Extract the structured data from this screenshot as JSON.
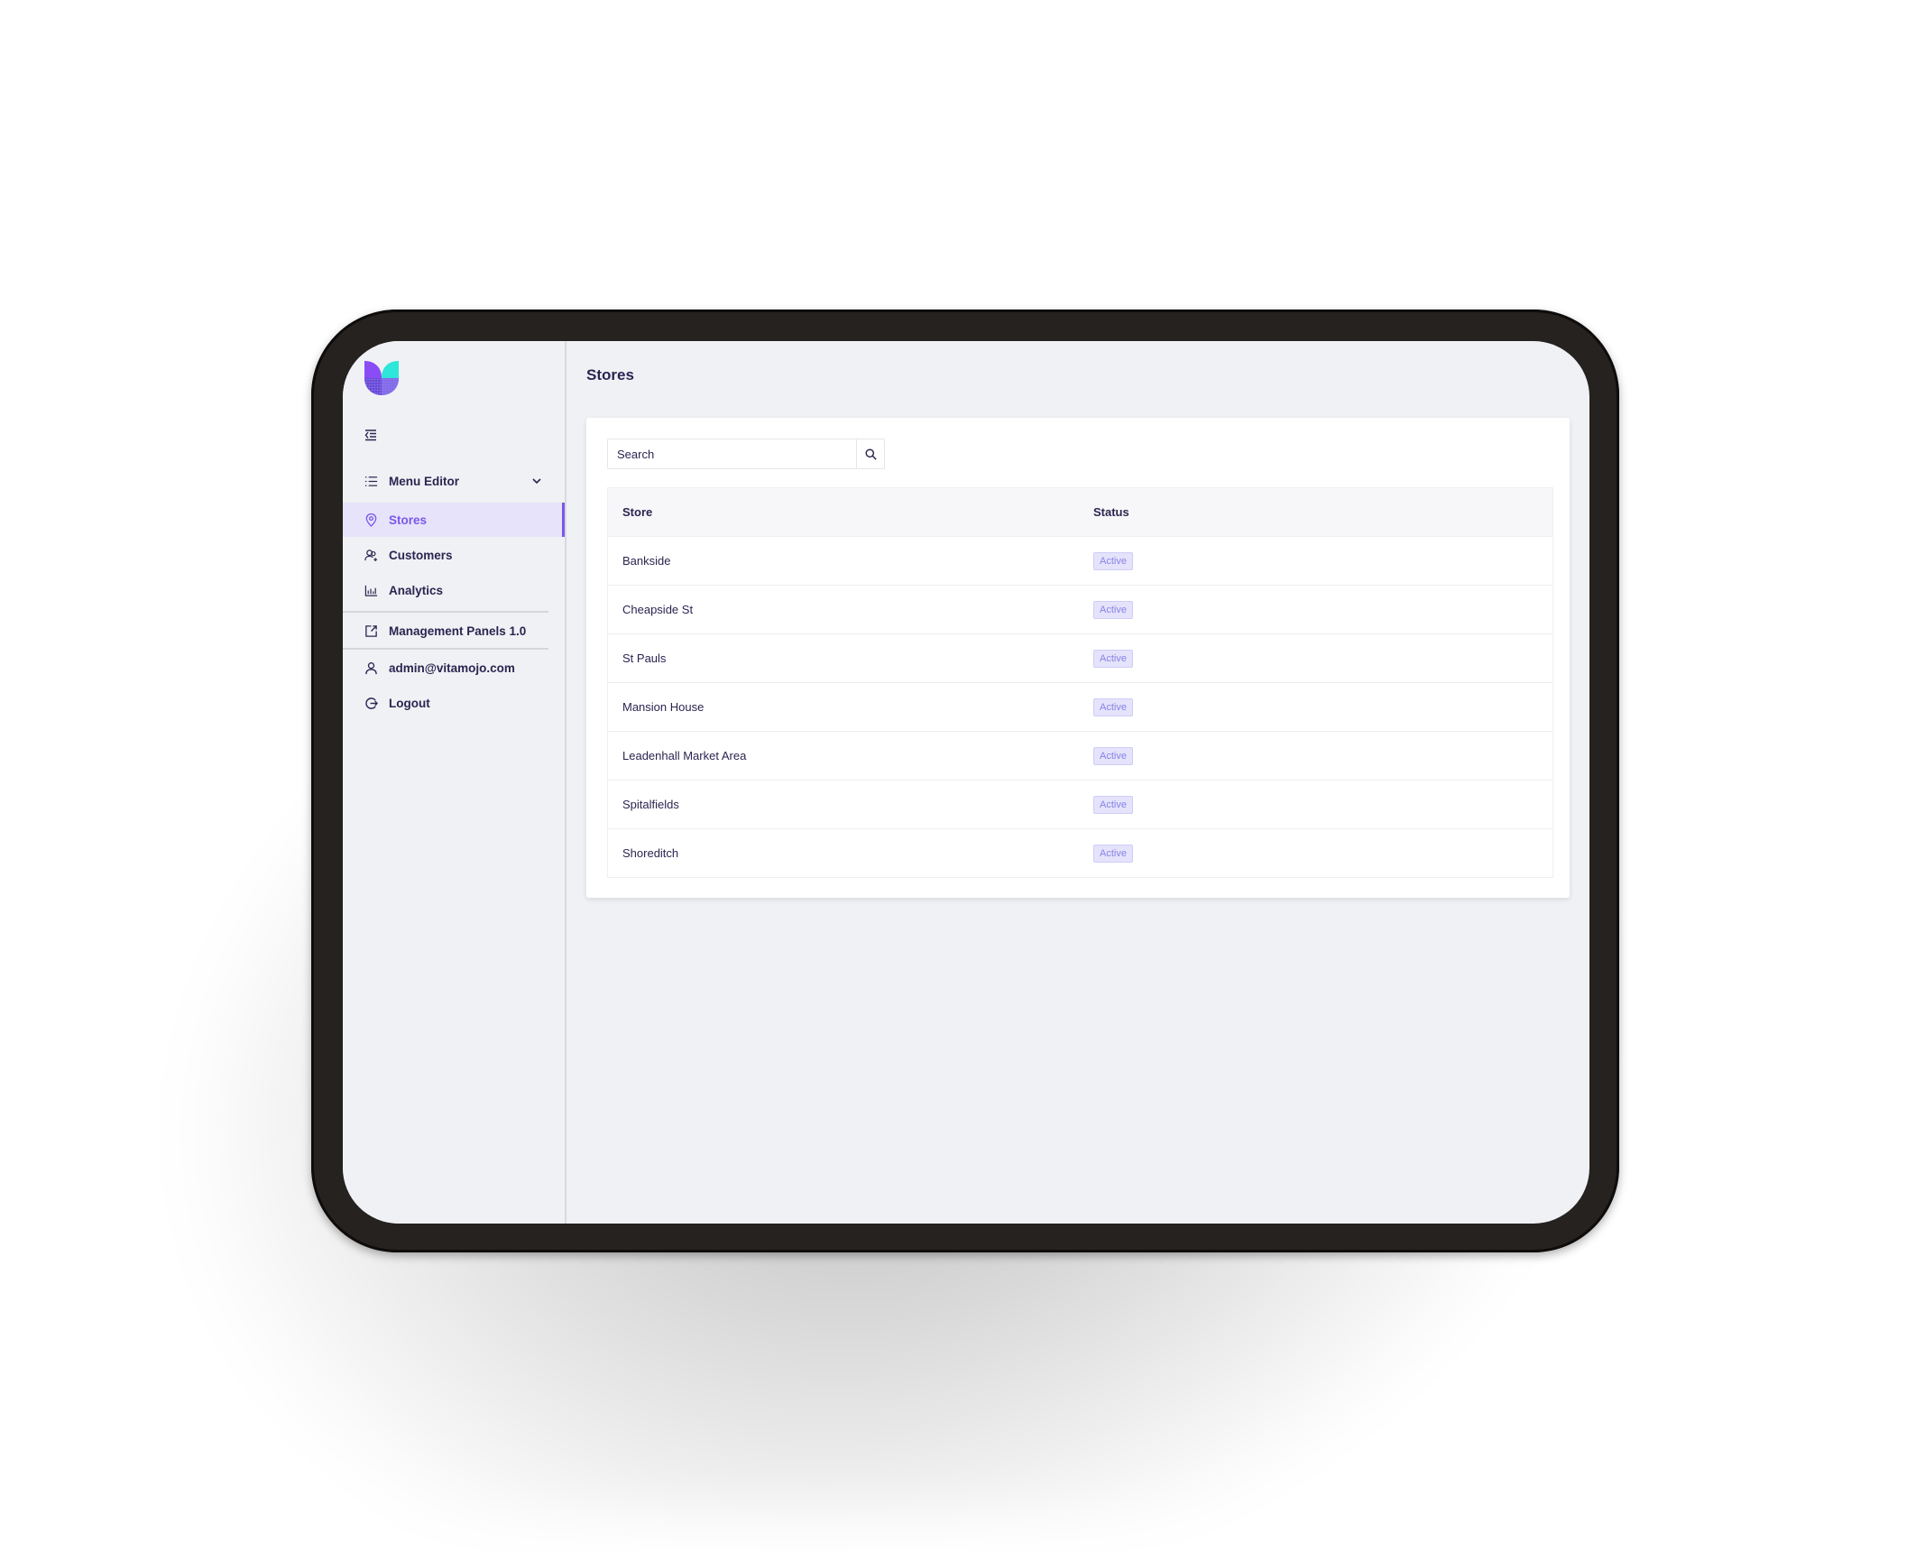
{
  "app": {
    "brand_colors": {
      "accent": "#7b57e8",
      "teal": "#2ee6d9",
      "text": "#2a2550"
    }
  },
  "sidebar": {
    "logo_icon": "vitamojo-leaf-logo",
    "collapse_icon": "collapse-menu-icon",
    "items": [
      {
        "label": "Menu Editor",
        "icon": "list-icon",
        "expandable": true
      },
      {
        "label": "Stores",
        "icon": "location-pin-icon",
        "active": true
      },
      {
        "label": "Customers",
        "icon": "users-icon"
      },
      {
        "label": "Analytics",
        "icon": "bar-chart-icon"
      },
      {
        "label": "Management Panels 1.0",
        "icon": "external-link-icon"
      },
      {
        "label": "admin@vitamojo.com",
        "icon": "user-icon"
      },
      {
        "label": "Logout",
        "icon": "logout-icon"
      }
    ]
  },
  "main": {
    "title": "Stores",
    "search": {
      "placeholder": "Search",
      "value": ""
    },
    "table": {
      "columns": [
        "Store",
        "Status"
      ],
      "rows": [
        {
          "store": "Bankside",
          "status": "Active"
        },
        {
          "store": "Cheapside St",
          "status": "Active"
        },
        {
          "store": "St Pauls",
          "status": "Active"
        },
        {
          "store": "Mansion House",
          "status": "Active"
        },
        {
          "store": "Leadenhall Market Area",
          "status": "Active"
        },
        {
          "store": "Spitalfields",
          "status": "Active"
        },
        {
          "store": "Shoreditch",
          "status": "Active"
        }
      ]
    }
  }
}
